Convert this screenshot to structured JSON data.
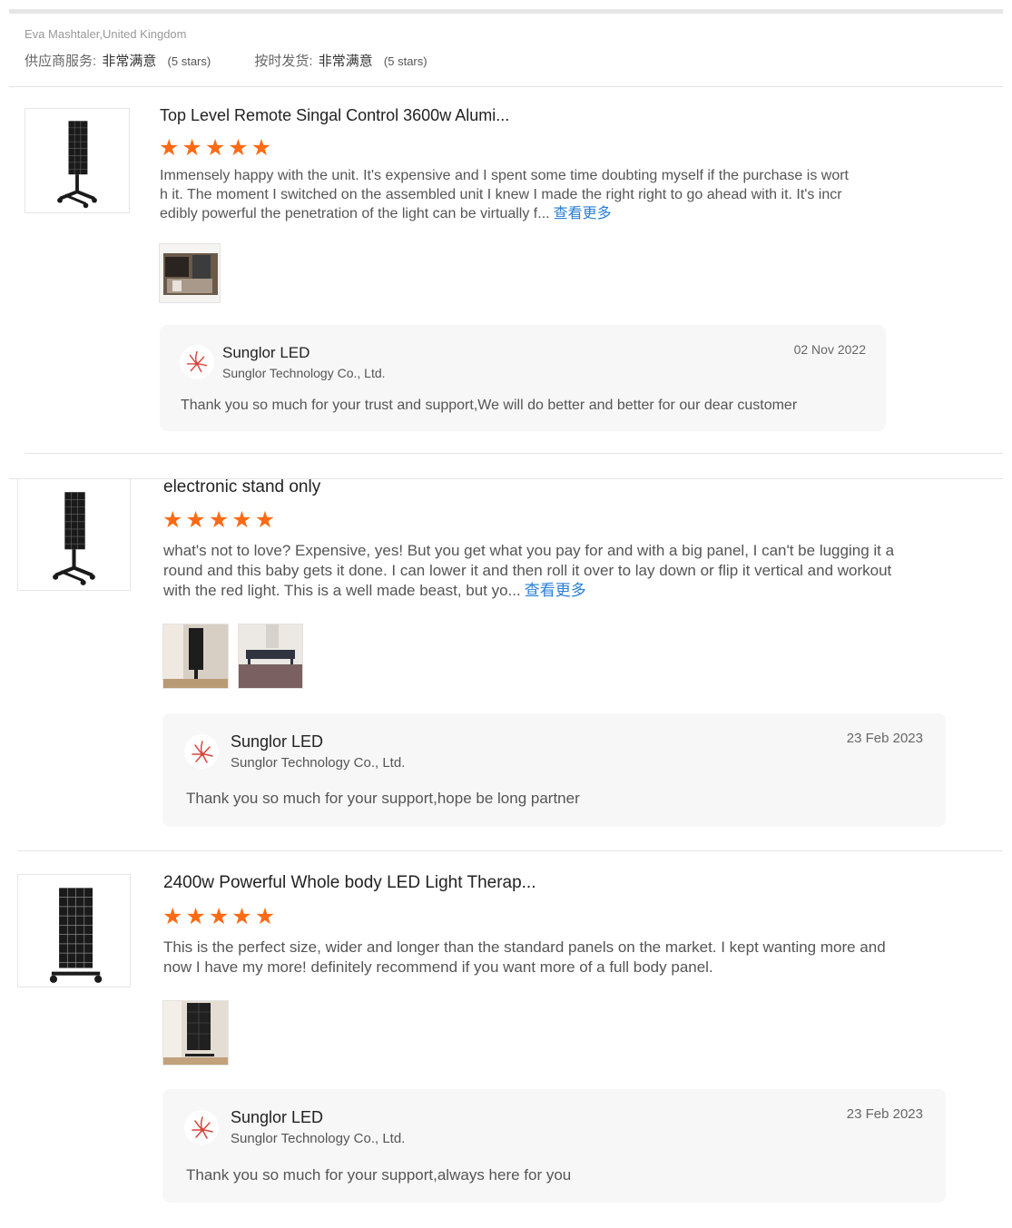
{
  "reviewer": {
    "name": "Eva Mashtaler,United Kingdom",
    "supplier_service_label": "供应商服务:",
    "supplier_service_value": "非常满意",
    "supplier_service_stars": "(5 stars)",
    "shipping_label": "按时发货:",
    "shipping_value": "非常满意",
    "shipping_stars": "(5 stars)"
  },
  "colors": {
    "star": "#ff6a14",
    "link": "#2a7fd6",
    "reply_bg": "#f7f7f7"
  },
  "reviews": [
    {
      "title": "Top Level Remote Singal Control 3600w Alumi...",
      "rating": 5,
      "text": "Immensely happy with the unit. It's expensive and I spent some time doubting myself if the purchase is worth it. The moment I switched on the assembled unit I knew I made the right right to go ahead with it. It's incredibly powerful the penetration of the light can be virtually f...",
      "more": "查看更多",
      "photos_count": 1,
      "reply": {
        "supplier": "Sunglor LED",
        "company": "Sunglor Technology Co., Ltd.",
        "date": "02 Nov 2022",
        "text": "Thank you so much for your trust and support,We will do better and better for our dear customer"
      }
    },
    {
      "title": "electronic stand only",
      "rating": 5,
      "text": "what's not to love? Expensive, yes! But you get what you pay for and with a big panel, I can't be lugging it around and this baby gets it done. I can lower it and then roll it over to lay down or flip it vertical and workout with the red light. This is a well made beast, but yo...",
      "more": "查看更多",
      "photos_count": 2,
      "reply": {
        "supplier": "Sunglor LED",
        "company": "Sunglor Technology Co., Ltd.",
        "date": "23 Feb 2023",
        "text": "Thank you so much for your support,hope be long partner"
      }
    },
    {
      "title": "2400w Powerful Whole body LED Light Therap...",
      "rating": 5,
      "text": "This is the perfect size, wider and longer than the standard panels on the market. I kept wanting more and now I have my more! definitely recommend if you want more of a full body panel.",
      "more": "",
      "photos_count": 1,
      "reply": {
        "supplier": "Sunglor LED",
        "company": "Sunglor Technology Co., Ltd.",
        "date": "23 Feb 2023",
        "text": "Thank you so much for your support,always here for you"
      }
    }
  ]
}
